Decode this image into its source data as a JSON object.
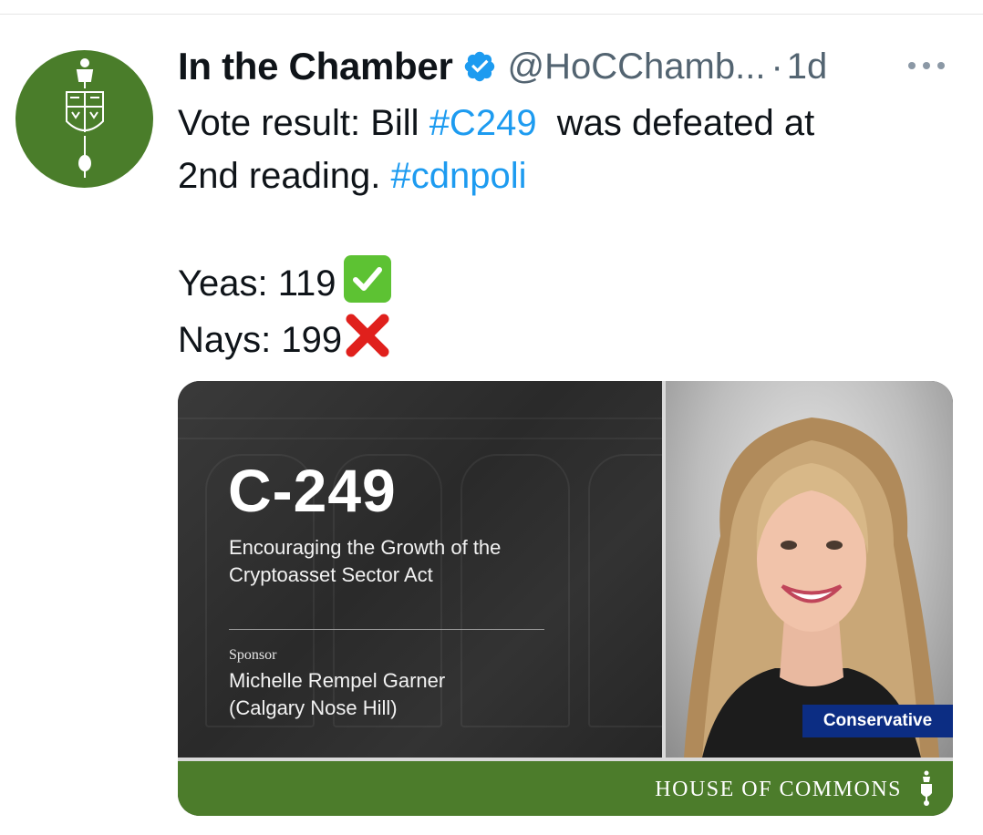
{
  "tweet": {
    "author": {
      "display_name": "In the Chamber",
      "handle": "@HoCChamb...",
      "verified": true,
      "avatar_color": "#4a7d2a",
      "avatar_icon": "parliament-mace-crest-icon"
    },
    "separator": "·",
    "timestamp": "1d",
    "more_icon": "more-options-icon",
    "text": {
      "line1_prefix": "Vote result: Bill ",
      "line1_hashtag": "#C249",
      "line1_suffix": "  was defeated at",
      "line2_prefix": "2nd reading. ",
      "line2_hashtag": "#cdnpoli",
      "yeas_text": "Yeas: 119",
      "yeas_emoji": "check-mark-emoji",
      "nays_text": "Nays: 199",
      "nays_emoji": "cross-mark-emoji"
    },
    "hashtag_color": "#1d9bf0"
  },
  "card": {
    "bill_number": "C-249",
    "bill_title": "Encouraging the Growth of the Cryptoasset Sector Act",
    "bill_title_line1": "Encouraging the Growth of the",
    "bill_title_line2": "Cryptoasset Sector Act",
    "sponsor_label": "Sponsor",
    "sponsor_name": "Michelle Rempel Garner",
    "sponsor_riding": "(Calgary Nose Hill)",
    "party": "Conservative",
    "party_color": "#0c2d83",
    "footer_text": "HOUSE OF COMMONS",
    "footer_color": "#4c7c2b",
    "footer_icon": "mace-icon"
  }
}
